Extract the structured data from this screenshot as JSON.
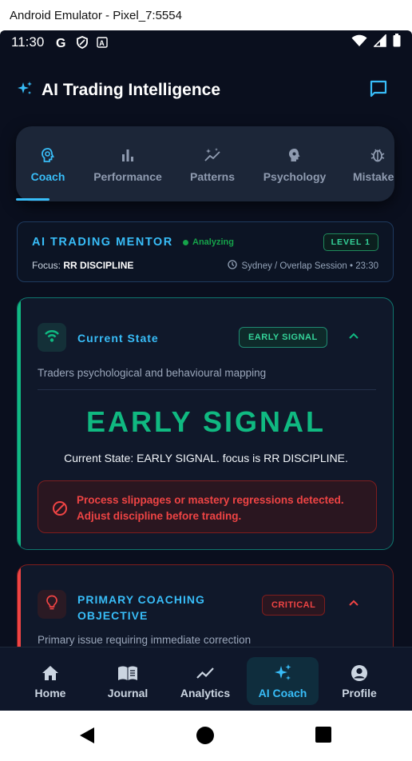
{
  "window": {
    "title": "Android Emulator - Pixel_7:5554"
  },
  "statusbar": {
    "time": "11:30"
  },
  "header": {
    "title": "AI Trading Intelligence",
    "chat_icon": "chat-bubble-icon"
  },
  "tabs": [
    {
      "label": "Coach",
      "icon": "brain-icon",
      "active": true
    },
    {
      "label": "Performance",
      "icon": "bar-chart-icon",
      "active": false
    },
    {
      "label": "Patterns",
      "icon": "sparkle-trend-icon",
      "active": false
    },
    {
      "label": "Psychology",
      "icon": "head-gear-icon",
      "active": false
    },
    {
      "label": "Mistakes",
      "icon": "bug-icon",
      "active": false
    }
  ],
  "mentor": {
    "title": "AI TRADING MENTOR",
    "status": "Analyzing",
    "level": "LEVEL 1",
    "focus_label": "Focus:",
    "focus_value": "RR DISCIPLINE",
    "session": "Sydney / Overlap Session • 23:30"
  },
  "current_state": {
    "title": "Current State",
    "badge": "EARLY SIGNAL",
    "subtitle": "Traders psychological and behavioural mapping",
    "big_label": "EARLY SIGNAL",
    "description": "Current State: EARLY SIGNAL. focus is RR DISCIPLINE.",
    "warning": "Process slippages or mastery regressions detected. Adjust discipline before trading."
  },
  "objective": {
    "title": "PRIMARY COACHING OBJECTIVE",
    "badge": "CRITICAL",
    "subtitle": "Primary issue requiring immediate correction"
  },
  "bottom_nav": [
    {
      "label": "Home",
      "icon": "home-icon",
      "active": false
    },
    {
      "label": "Journal",
      "icon": "book-icon",
      "active": false
    },
    {
      "label": "Analytics",
      "icon": "trend-line-icon",
      "active": false
    },
    {
      "label": "AI Coach",
      "icon": "sparkles-icon",
      "active": true
    },
    {
      "label": "Profile",
      "icon": "profile-icon",
      "active": false
    }
  ],
  "colors": {
    "accent": "#38bdf8",
    "success": "#10b981",
    "danger": "#ef4444",
    "background": "#0a0f1e"
  }
}
